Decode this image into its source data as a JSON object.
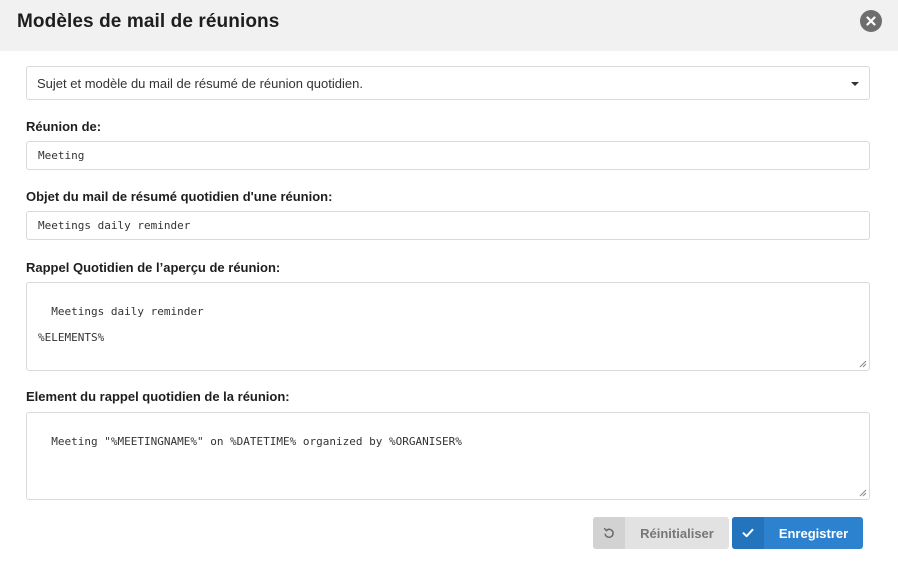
{
  "dialog": {
    "title": "Modèles de mail de réunions",
    "close_icon": "close-circle-icon"
  },
  "template_select": {
    "value": "Sujet et modèle du mail de résumé de réunion quotidien."
  },
  "fields": {
    "meeting_of": {
      "label": "Réunion de:",
      "value": "Meeting"
    },
    "subject": {
      "label": "Objet du mail de résumé quotidien d'une réunion:",
      "value": "Meetings daily reminder"
    },
    "overview": {
      "label": "Rappel Quotidien de l’aperçu de réunion:",
      "value": "Meetings daily reminder\n\n%ELEMENTS%"
    },
    "element": {
      "label": "Element du rappel quotidien de la réunion:",
      "value": "Meeting \"%MEETINGNAME%\" on %DATETIME% organized by %ORGANISER%"
    }
  },
  "buttons": {
    "reset_label": "Réinitialiser",
    "reset_icon": "undo-icon",
    "save_label": "Enregistrer",
    "save_icon": "checkmark-icon"
  },
  "colors": {
    "header_bg": "#f1f1f1",
    "primary": "#2d82d0",
    "secondary": "#e2e2e2"
  }
}
